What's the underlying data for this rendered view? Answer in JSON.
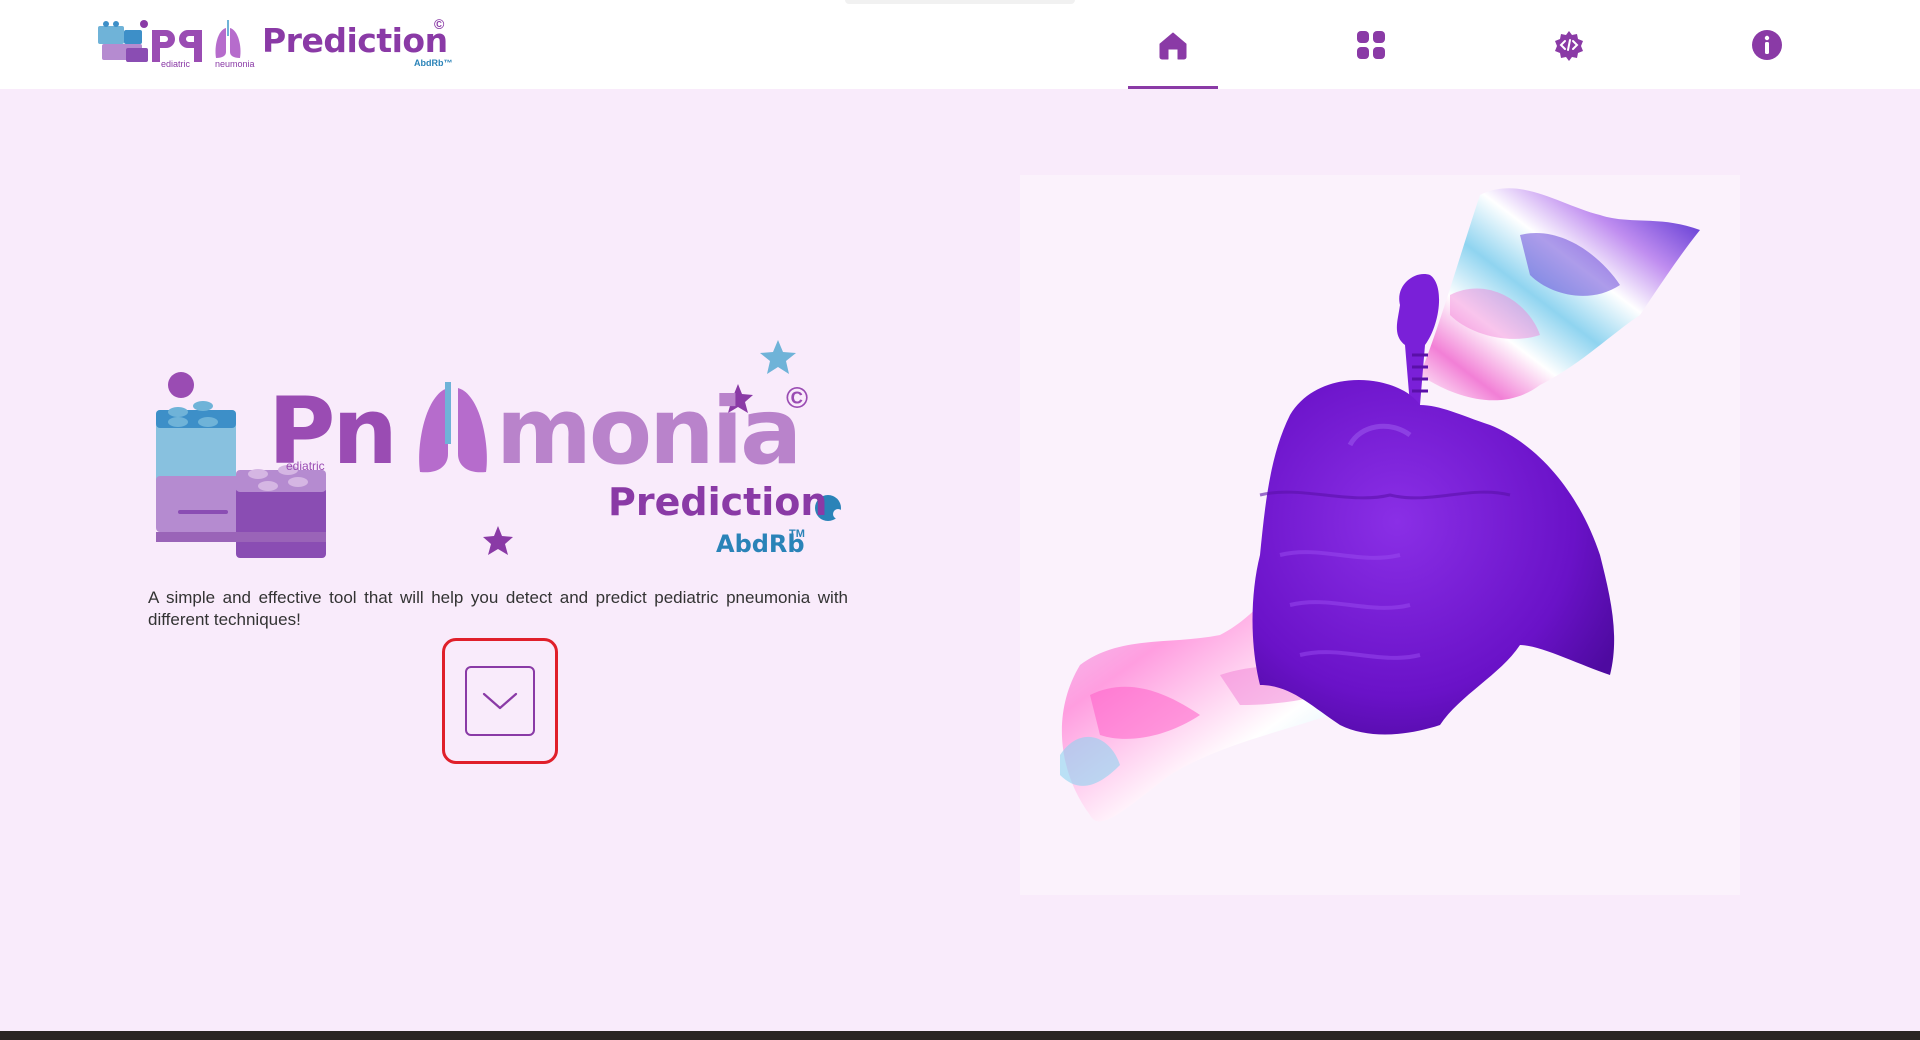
{
  "app": {
    "brand_title": "Prediction",
    "brand_copyright": "©",
    "brand_sub_left": "ediatric",
    "brand_sub_right": "neumonia",
    "brand_tag": "AbdRb™"
  },
  "nav": {
    "items": [
      {
        "name": "home",
        "icon": "home-icon",
        "active": true
      },
      {
        "name": "apps",
        "icon": "grid-icon",
        "active": false
      },
      {
        "name": "developer",
        "icon": "code-gear-icon",
        "active": false
      },
      {
        "name": "about",
        "icon": "info-icon",
        "active": false
      }
    ]
  },
  "hero": {
    "logo_word_start": "Pn",
    "logo_word_end": "monia",
    "logo_small": "ediatric",
    "logo_copyright": "©",
    "logo_prediction": "Prediction",
    "logo_brand": "AbdRb",
    "logo_tm": "TM",
    "tagline": "A simple and effective tool that will help you detect and predict pediatric pneumonia with different techniques!",
    "scroll_button_icon": "chevron-down-icon"
  },
  "colors": {
    "background": "#f9ebfb",
    "primary": "#8a3aa6",
    "accent_blue": "#2a83b8",
    "highlight_border": "#e01f2a"
  }
}
